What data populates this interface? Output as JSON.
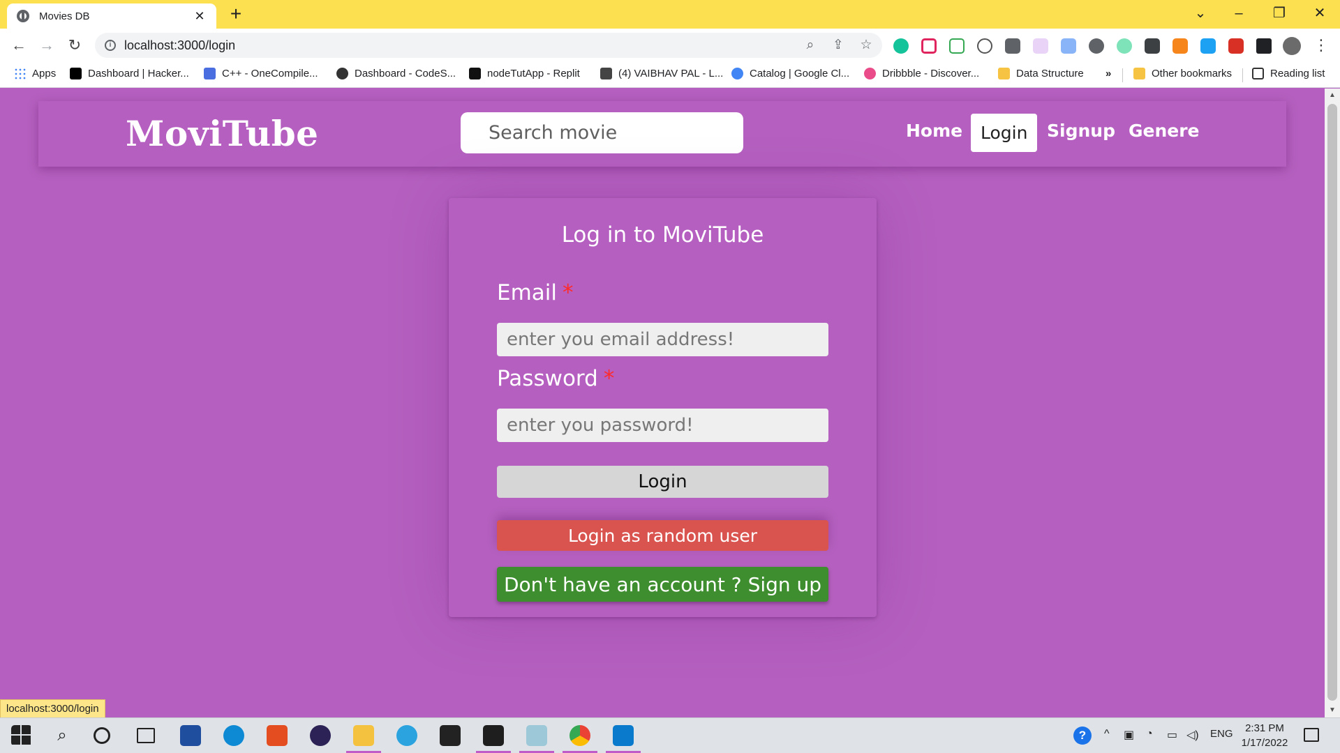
{
  "browser": {
    "tab_title": "Movies DB",
    "tab_close": "✕",
    "new_tab": "+",
    "url": "localhost:3000/login",
    "bookmarks": [
      {
        "label": "Apps",
        "color": "#ea4335"
      },
      {
        "label": "Dashboard | Hacker...",
        "color": "#000000"
      },
      {
        "label": "C++ - OneCompile...",
        "color": "#4a6ee0"
      },
      {
        "label": "Dashboard - CodeS...",
        "color": "#333333"
      },
      {
        "label": "nodeTutApp - Replit",
        "color": "#111111"
      },
      {
        "label": "(4) VAIBHAV PAL - L...",
        "color": "#444444"
      },
      {
        "label": "Catalog | Google Cl...",
        "color": "#4285f4"
      },
      {
        "label": "Dribbble - Discover...",
        "color": "#ea4c89"
      },
      {
        "label": "Data Structure",
        "color": "#f6c343"
      }
    ],
    "more_bookmarks": "»",
    "other_bookmarks": "Other bookmarks",
    "reading_list": "Reading list",
    "status_url": "localhost:3000/login"
  },
  "app": {
    "brand": "MoviTube",
    "search_placeholder": "Search movie",
    "nav": {
      "home": "Home",
      "login": "Login",
      "signup": "Signup",
      "genere": "Genere"
    }
  },
  "login_form": {
    "title": "Log in to MoviTube",
    "email_label": "Email",
    "required_mark": "*",
    "email_placeholder": "enter you email address!",
    "password_label": "Password",
    "password_placeholder": "enter you password!",
    "login_button": "Login",
    "random_user_button": "Login as random user",
    "signup_button": "Don't have an account ? Sign up"
  },
  "colors": {
    "page_bg": "#b560c0",
    "random_user_btn": "#d9534f",
    "signup_btn": "#3e8e2f",
    "login_btn": "#d6d6d6",
    "required": "#ff2a2a",
    "chrome_tab_strip": "#fde050"
  },
  "taskbar": {
    "language": "ENG",
    "time": "2:31 PM",
    "date": "1/17/2022"
  }
}
